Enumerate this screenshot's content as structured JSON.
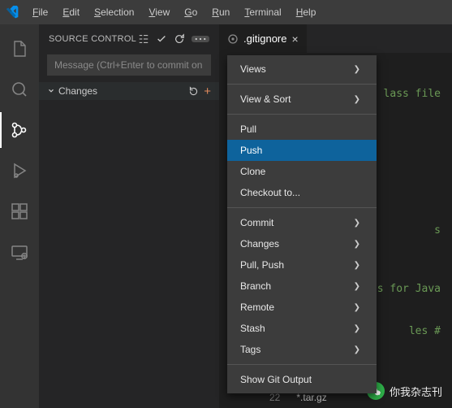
{
  "menu": [
    "File",
    "Edit",
    "Selection",
    "View",
    "Go",
    "Run",
    "Terminal",
    "Help"
  ],
  "sidebar": {
    "title": "SOURCE CONTROL",
    "message_placeholder": "Message (Ctrl+Enter to commit on",
    "changes_label": "Changes"
  },
  "tab": {
    "name": ".gitignore"
  },
  "editor_lines": {
    "a": "lass file",
    "b": "s",
    "c": "ls for Java",
    "d": "les #"
  },
  "context_menu": {
    "views": "Views",
    "view_sort": "View & Sort",
    "pull": "Pull",
    "push": "Push",
    "clone": "Clone",
    "checkout": "Checkout to...",
    "commit": "Commit",
    "changes": "Changes",
    "pull_push": "Pull, Push",
    "branch": "Branch",
    "remote": "Remote",
    "stash": "Stash",
    "tags": "Tags",
    "show_git_output": "Show Git Output"
  },
  "status": {
    "line_no": "22",
    "filename": "*.tar.gz"
  },
  "watermark": "你我杂志刊"
}
